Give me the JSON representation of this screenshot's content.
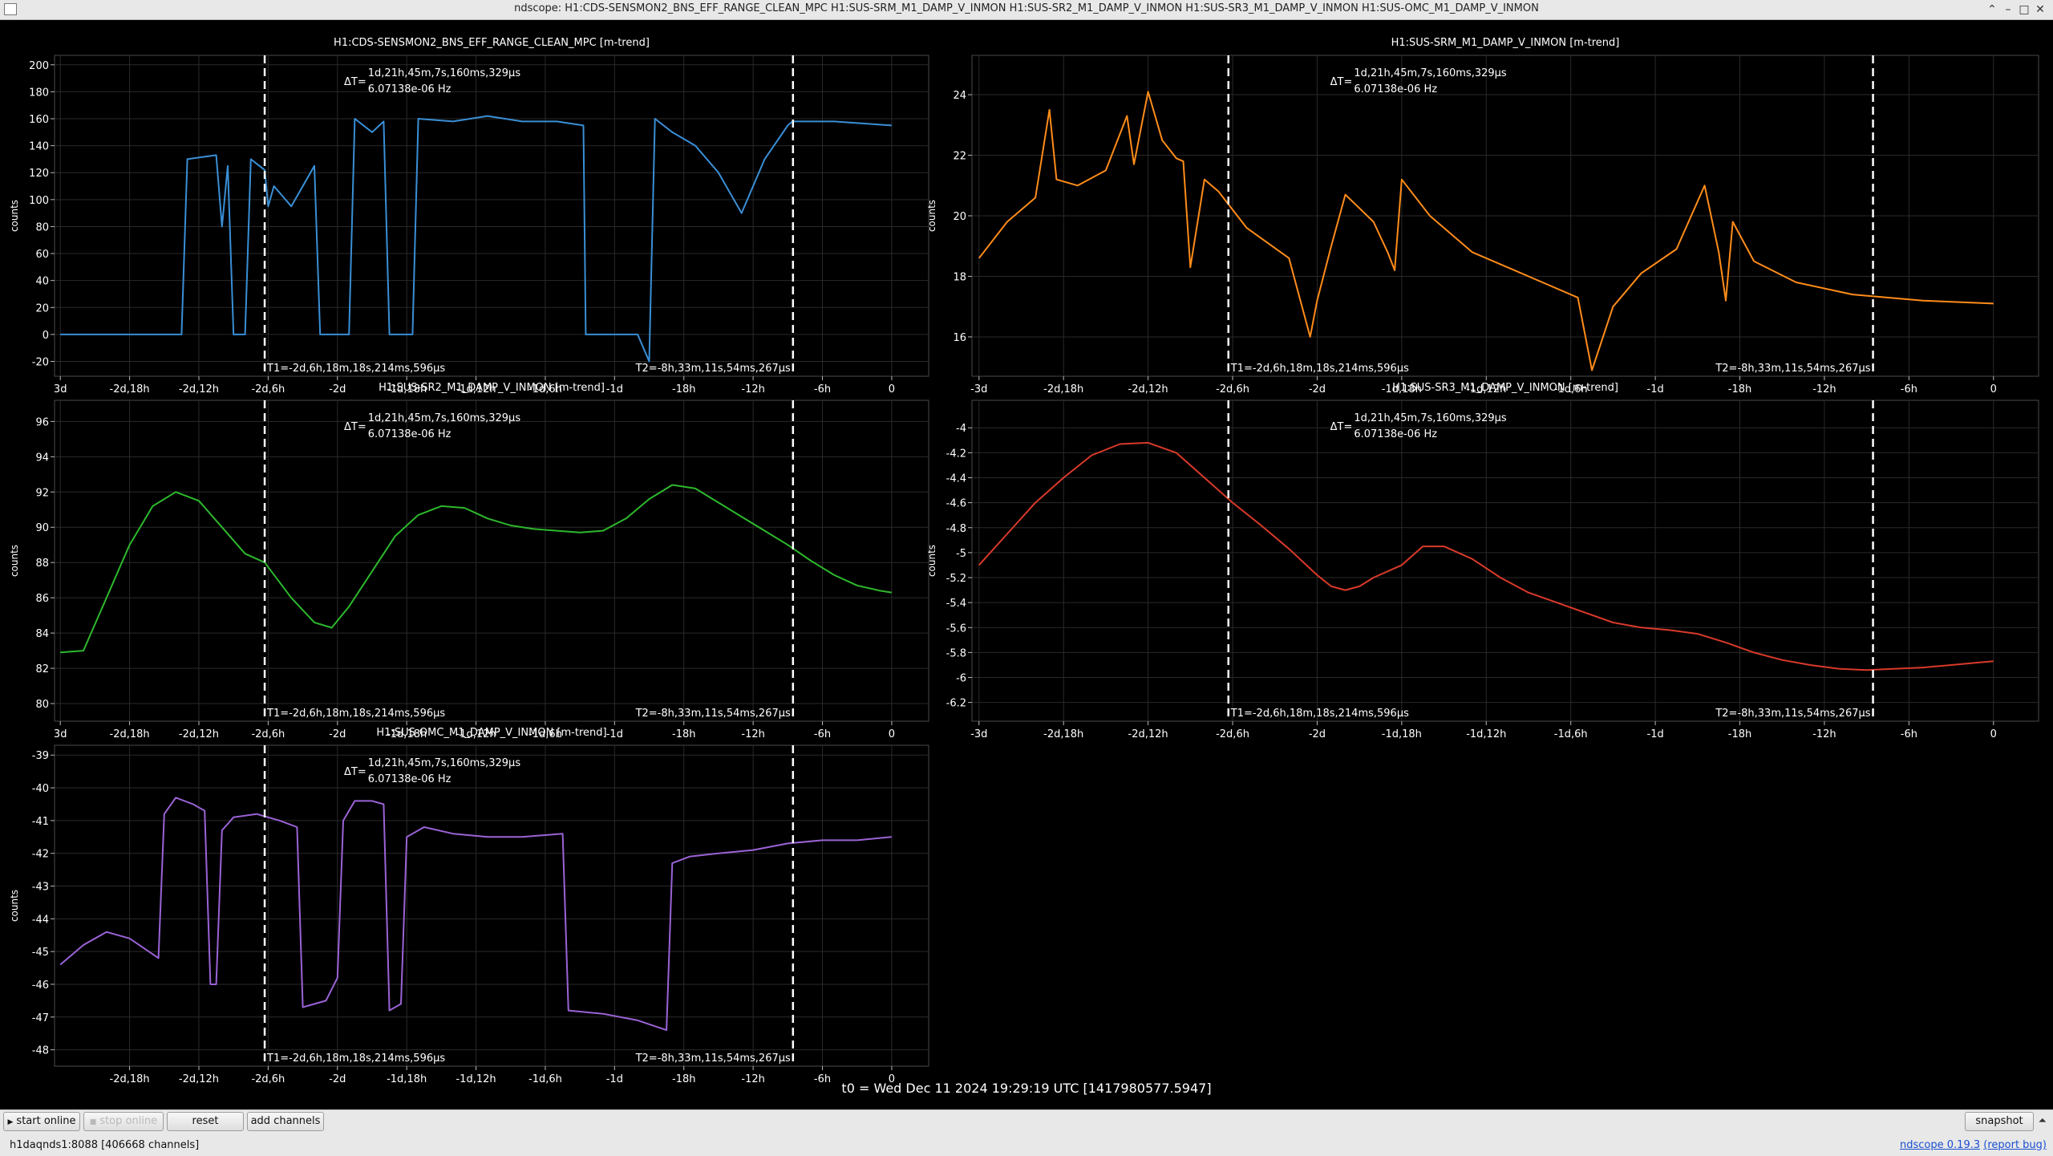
{
  "window": {
    "title": "ndscope: H1:CDS-SENSMON2_BNS_EFF_RANGE_CLEAN_MPC H1:SUS-SRM_M1_DAMP_V_INMON H1:SUS-SR2_M1_DAMP_V_INMON H1:SUS-SR3_M1_DAMP_V_INMON H1:SUS-OMC_M1_DAMP_V_INMON",
    "buttons": {
      "minimize": "–",
      "maximize": "□",
      "close": "✕",
      "extra": "⌃"
    }
  },
  "cursors": {
    "dt_label": "ΔT=",
    "dt_value": "1d,21h,45m,7s,160ms,329µs",
    "freq": "6.07138e-06 Hz",
    "t1": "T1=-2d,6h,18m,18s,214ms,596µs",
    "t2": "T2=-8h,33m,11s,54ms,267µs"
  },
  "colors": {
    "background": "#000000",
    "grid": "#2a2a2a",
    "cursor": "#ffffff"
  },
  "t0_label": "t0 = Wed Dec 11 2024 19:29:19 UTC [1417980577.5947]",
  "toolbar": {
    "start_online": "start online",
    "stop_online": "stop online",
    "reset": "reset",
    "add_channels": "add channels",
    "snapshot": "snapshot",
    "arrow": "⏶"
  },
  "status": {
    "server": "h1daqnds1:8088  [406668 channels]",
    "version_prefix": "ndscope",
    "version": "0.19.3",
    "report_bug": "(report bug)"
  },
  "chart_data": [
    {
      "type": "line",
      "title": "H1:CDS-SENSMON2_BNS_EFF_RANGE_CLEAN_MPC [m-trend]",
      "ylabel": "counts",
      "color": "#3a8fd6",
      "x_ticks": [
        {
          "x": -72,
          "label": "3d"
        },
        {
          "x": -66,
          "label": "-2d,18h"
        },
        {
          "x": -60,
          "label": "-2d,12h"
        },
        {
          "x": -54,
          "label": "-2d,6h"
        },
        {
          "x": -48,
          "label": "-2d"
        },
        {
          "x": -42,
          "label": "-1d,18h"
        },
        {
          "x": -36,
          "label": "-1d,12h"
        },
        {
          "x": -30,
          "label": "-1d,6h"
        },
        {
          "x": -24,
          "label": "-1d"
        },
        {
          "x": -18,
          "label": "-18h"
        },
        {
          "x": -12,
          "label": "-12h"
        },
        {
          "x": -6,
          "label": "-6h"
        },
        {
          "x": 0,
          "label": "0"
        }
      ],
      "y_ticks": [
        -20,
        0,
        20,
        40,
        60,
        80,
        100,
        120,
        140,
        160,
        180,
        200
      ],
      "xlim": [
        -72.5,
        3.2
      ],
      "ylim": [
        -31,
        207
      ],
      "cursor_x": [
        -54.3,
        -8.55
      ],
      "points": [
        [
          -72,
          0
        ],
        [
          -61.5,
          0
        ],
        [
          -61,
          130
        ],
        [
          -58.5,
          133
        ],
        [
          -58,
          80
        ],
        [
          -57.5,
          125
        ],
        [
          -57,
          0
        ],
        [
          -56,
          0
        ],
        [
          -55.5,
          130
        ],
        [
          -54.3,
          122
        ],
        [
          -54,
          95
        ],
        [
          -53.5,
          110
        ],
        [
          -52,
          95
        ],
        [
          -50,
          125
        ],
        [
          -49.5,
          0
        ],
        [
          -47,
          0
        ],
        [
          -46.5,
          160
        ],
        [
          -45,
          150
        ],
        [
          -44,
          158
        ],
        [
          -43.5,
          0
        ],
        [
          -41.5,
          0
        ],
        [
          -41,
          160
        ],
        [
          -38,
          158
        ],
        [
          -35,
          162
        ],
        [
          -32,
          158
        ],
        [
          -29,
          158
        ],
        [
          -26.7,
          155
        ],
        [
          -26.5,
          0
        ],
        [
          -22,
          0
        ],
        [
          -21,
          -20
        ],
        [
          -20.5,
          160
        ],
        [
          -19,
          150
        ],
        [
          -17,
          140
        ],
        [
          -15,
          120
        ],
        [
          -13,
          90
        ],
        [
          -11,
          130
        ],
        [
          -9,
          155
        ],
        [
          -8.6,
          158
        ],
        [
          -5,
          158
        ],
        [
          0,
          155
        ]
      ]
    },
    {
      "type": "line",
      "title": "H1:SUS-SRM_M1_DAMP_V_INMON [m-trend]",
      "ylabel": "counts",
      "color": "#ff8c1a",
      "x_ticks": [
        {
          "x": -72,
          "label": "-3d"
        },
        {
          "x": -66,
          "label": "-2d,18h"
        },
        {
          "x": -60,
          "label": "-2d,12h"
        },
        {
          "x": -54,
          "label": "-2d,6h"
        },
        {
          "x": -48,
          "label": "-2d"
        },
        {
          "x": -42,
          "label": "-1d,18h"
        },
        {
          "x": -36,
          "label": "-1d,12h"
        },
        {
          "x": -30,
          "label": "-1d,6h"
        },
        {
          "x": -24,
          "label": "-1d"
        },
        {
          "x": -18,
          "label": "-18h"
        },
        {
          "x": -12,
          "label": "-12h"
        },
        {
          "x": -6,
          "label": "-6h"
        },
        {
          "x": 0,
          "label": "0"
        }
      ],
      "y_ticks": [
        16,
        18,
        20,
        22,
        24
      ],
      "xlim": [
        -72.5,
        3.2
      ],
      "ylim": [
        14.7,
        25.3
      ],
      "cursor_x": [
        -54.3,
        -8.55
      ],
      "points": [
        [
          -72,
          18.6
        ],
        [
          -70,
          19.8
        ],
        [
          -68,
          20.6
        ],
        [
          -67,
          23.5
        ],
        [
          -66.5,
          21.2
        ],
        [
          -65,
          21.0
        ],
        [
          -63,
          21.5
        ],
        [
          -61.5,
          23.3
        ],
        [
          -61,
          21.7
        ],
        [
          -60,
          24.1
        ],
        [
          -59,
          22.5
        ],
        [
          -58,
          21.9
        ],
        [
          -57.5,
          21.8
        ],
        [
          -57,
          18.3
        ],
        [
          -56,
          21.2
        ],
        [
          -55,
          20.8
        ],
        [
          -53,
          19.6
        ],
        [
          -50,
          18.6
        ],
        [
          -48.5,
          16.0
        ],
        [
          -48,
          17.2
        ],
        [
          -47,
          19.0
        ],
        [
          -46,
          20.7
        ],
        [
          -44,
          19.8
        ],
        [
          -43,
          18.8
        ],
        [
          -42.5,
          18.2
        ],
        [
          -42,
          21.2
        ],
        [
          -40,
          20.0
        ],
        [
          -37,
          18.8
        ],
        [
          -33,
          18.0
        ],
        [
          -29.5,
          17.3
        ],
        [
          -28.5,
          14.9
        ],
        [
          -27,
          17.0
        ],
        [
          -25,
          18.1
        ],
        [
          -22.5,
          18.9
        ],
        [
          -20.5,
          21.0
        ],
        [
          -19.5,
          18.8
        ],
        [
          -19,
          17.2
        ],
        [
          -18.5,
          19.8
        ],
        [
          -17,
          18.5
        ],
        [
          -14,
          17.8
        ],
        [
          -10,
          17.4
        ],
        [
          -5,
          17.2
        ],
        [
          0,
          17.1
        ]
      ]
    },
    {
      "type": "line",
      "title": "H1:SUS-SR2_M1_DAMP_V_INMON [m-trend]",
      "ylabel": "counts",
      "color": "#2db82d",
      "x_ticks": [
        {
          "x": -72,
          "label": "3d"
        },
        {
          "x": -66,
          "label": "-2d,18h"
        },
        {
          "x": -60,
          "label": "-2d,12h"
        },
        {
          "x": -54,
          "label": "-2d,6h"
        },
        {
          "x": -48,
          "label": "-2d"
        },
        {
          "x": -42,
          "label": "-1d,18h"
        },
        {
          "x": -36,
          "label": "-1d,12h"
        },
        {
          "x": -30,
          "label": "-1d,6h"
        },
        {
          "x": -24,
          "label": "-1d"
        },
        {
          "x": -18,
          "label": "-18h"
        },
        {
          "x": -12,
          "label": "-12h"
        },
        {
          "x": -6,
          "label": "-6h"
        },
        {
          "x": 0,
          "label": "0"
        }
      ],
      "y_ticks": [
        80,
        82,
        84,
        86,
        88,
        90,
        92,
        94,
        96
      ],
      "xlim": [
        -72.5,
        3.2
      ],
      "ylim": [
        79,
        97.2
      ],
      "cursor_x": [
        -54.3,
        -8.55
      ],
      "points": [
        [
          -72,
          82.9
        ],
        [
          -70,
          83.0
        ],
        [
          -68,
          86.0
        ],
        [
          -66,
          89.0
        ],
        [
          -64,
          91.2
        ],
        [
          -62,
          92.0
        ],
        [
          -60,
          91.5
        ],
        [
          -58,
          90.0
        ],
        [
          -56,
          88.5
        ],
        [
          -54.3,
          88.0
        ],
        [
          -52,
          86.0
        ],
        [
          -50,
          84.6
        ],
        [
          -48.5,
          84.3
        ],
        [
          -47,
          85.5
        ],
        [
          -45,
          87.5
        ],
        [
          -43,
          89.5
        ],
        [
          -41,
          90.7
        ],
        [
          -39,
          91.2
        ],
        [
          -37,
          91.1
        ],
        [
          -35,
          90.5
        ],
        [
          -33,
          90.1
        ],
        [
          -31,
          89.9
        ],
        [
          -29,
          89.8
        ],
        [
          -27,
          89.7
        ],
        [
          -25,
          89.8
        ],
        [
          -23,
          90.5
        ],
        [
          -21,
          91.6
        ],
        [
          -19,
          92.4
        ],
        [
          -17,
          92.2
        ],
        [
          -15,
          91.4
        ],
        [
          -13,
          90.6
        ],
        [
          -11,
          89.8
        ],
        [
          -9,
          89.0
        ],
        [
          -7,
          88.1
        ],
        [
          -5,
          87.3
        ],
        [
          -3,
          86.7
        ],
        [
          -1,
          86.4
        ],
        [
          0,
          86.3
        ]
      ]
    },
    {
      "type": "line",
      "title": "H1:SUS-SR3_M1_DAMP_V_INMON [m-trend]",
      "ylabel": "counts",
      "color": "#d93a2a",
      "x_ticks": [
        {
          "x": -72,
          "label": "-3d"
        },
        {
          "x": -66,
          "label": "-2d,18h"
        },
        {
          "x": -60,
          "label": "-2d,12h"
        },
        {
          "x": -54,
          "label": "-2d,6h"
        },
        {
          "x": -48,
          "label": "-2d"
        },
        {
          "x": -42,
          "label": "-1d,18h"
        },
        {
          "x": -36,
          "label": "-1d,12h"
        },
        {
          "x": -30,
          "label": "-1d,6h"
        },
        {
          "x": -24,
          "label": "-1d"
        },
        {
          "x": -18,
          "label": "-18h"
        },
        {
          "x": -12,
          "label": "-12h"
        },
        {
          "x": -6,
          "label": "-6h"
        },
        {
          "x": 0,
          "label": "0"
        }
      ],
      "y_ticks": [
        -6.2,
        -6,
        -5.8,
        -5.6,
        -5.4,
        -5.2,
        -5,
        -4.8,
        -4.6,
        -4.4,
        -4.2,
        -4
      ],
      "xlim": [
        -72.5,
        3.2
      ],
      "ylim": [
        -6.35,
        -3.78
      ],
      "cursor_x": [
        -54.3,
        -8.55
      ],
      "points": [
        [
          -72,
          -5.1
        ],
        [
          -70,
          -4.85
        ],
        [
          -68,
          -4.6
        ],
        [
          -66,
          -4.4
        ],
        [
          -64,
          -4.22
        ],
        [
          -62,
          -4.13
        ],
        [
          -60,
          -4.12
        ],
        [
          -58,
          -4.2
        ],
        [
          -56,
          -4.4
        ],
        [
          -54,
          -4.6
        ],
        [
          -52,
          -4.78
        ],
        [
          -50,
          -4.97
        ],
        [
          -48,
          -5.18
        ],
        [
          -47,
          -5.27
        ],
        [
          -46,
          -5.3
        ],
        [
          -45,
          -5.27
        ],
        [
          -44,
          -5.2
        ],
        [
          -43,
          -5.15
        ],
        [
          -42,
          -5.1
        ],
        [
          -40.5,
          -4.95
        ],
        [
          -39,
          -4.95
        ],
        [
          -37,
          -5.05
        ],
        [
          -35,
          -5.2
        ],
        [
          -33,
          -5.32
        ],
        [
          -31,
          -5.4
        ],
        [
          -29,
          -5.48
        ],
        [
          -27,
          -5.56
        ],
        [
          -25,
          -5.6
        ],
        [
          -23,
          -5.62
        ],
        [
          -21,
          -5.65
        ],
        [
          -19,
          -5.72
        ],
        [
          -17,
          -5.8
        ],
        [
          -15,
          -5.86
        ],
        [
          -13,
          -5.9
        ],
        [
          -11,
          -5.93
        ],
        [
          -9,
          -5.94
        ],
        [
          -7,
          -5.93
        ],
        [
          -5,
          -5.92
        ],
        [
          -3,
          -5.9
        ],
        [
          -1,
          -5.88
        ],
        [
          0,
          -5.87
        ]
      ]
    },
    {
      "type": "line",
      "title": "H1:SUS-OMC_M1_DAMP_V_INMON [m-trend]",
      "ylabel": "counts",
      "color": "#9b63d6",
      "x_ticks": [
        {
          "x": -66,
          "label": "-2d,18h"
        },
        {
          "x": -60,
          "label": "-2d,12h"
        },
        {
          "x": -54,
          "label": "-2d,6h"
        },
        {
          "x": -48,
          "label": "-2d"
        },
        {
          "x": -42,
          "label": "-1d,18h"
        },
        {
          "x": -36,
          "label": "-1d,12h"
        },
        {
          "x": -30,
          "label": "-1d,6h"
        },
        {
          "x": -24,
          "label": "-1d"
        },
        {
          "x": -18,
          "label": "-18h"
        },
        {
          "x": -12,
          "label": "-12h"
        },
        {
          "x": -6,
          "label": "-6h"
        },
        {
          "x": 0,
          "label": "0"
        }
      ],
      "y_ticks": [
        -48,
        -47,
        -46,
        -45,
        -44,
        -43,
        -42,
        -41,
        -40,
        -39
      ],
      "xlim": [
        -72.5,
        3.2
      ],
      "ylim": [
        -48.5,
        -38.7
      ],
      "cursor_x": [
        -54.3,
        -8.55
      ],
      "points": [
        [
          -72,
          -45.4
        ],
        [
          -70,
          -44.8
        ],
        [
          -68,
          -44.4
        ],
        [
          -66,
          -44.6
        ],
        [
          -63.5,
          -45.2
        ],
        [
          -63,
          -40.8
        ],
        [
          -62,
          -40.3
        ],
        [
          -60.5,
          -40.5
        ],
        [
          -59.5,
          -40.7
        ],
        [
          -59,
          -46.0
        ],
        [
          -58.5,
          -46.0
        ],
        [
          -58,
          -41.3
        ],
        [
          -57,
          -40.9
        ],
        [
          -55,
          -40.8
        ],
        [
          -53,
          -41.0
        ],
        [
          -51.5,
          -41.2
        ],
        [
          -51,
          -46.7
        ],
        [
          -49,
          -46.5
        ],
        [
          -48,
          -45.8
        ],
        [
          -47.5,
          -41.0
        ],
        [
          -46.5,
          -40.4
        ],
        [
          -45,
          -40.4
        ],
        [
          -44,
          -40.5
        ],
        [
          -43.5,
          -46.8
        ],
        [
          -42.5,
          -46.6
        ],
        [
          -42,
          -41.5
        ],
        [
          -40.5,
          -41.2
        ],
        [
          -38,
          -41.4
        ],
        [
          -35,
          -41.5
        ],
        [
          -32,
          -41.5
        ],
        [
          -28.5,
          -41.4
        ],
        [
          -28,
          -46.8
        ],
        [
          -25,
          -46.9
        ],
        [
          -22,
          -47.1
        ],
        [
          -19.5,
          -47.4
        ],
        [
          -19,
          -42.3
        ],
        [
          -17.5,
          -42.1
        ],
        [
          -15,
          -42.0
        ],
        [
          -12,
          -41.9
        ],
        [
          -9,
          -41.7
        ],
        [
          -6,
          -41.6
        ],
        [
          -3,
          -41.6
        ],
        [
          0,
          -41.5
        ]
      ]
    }
  ]
}
